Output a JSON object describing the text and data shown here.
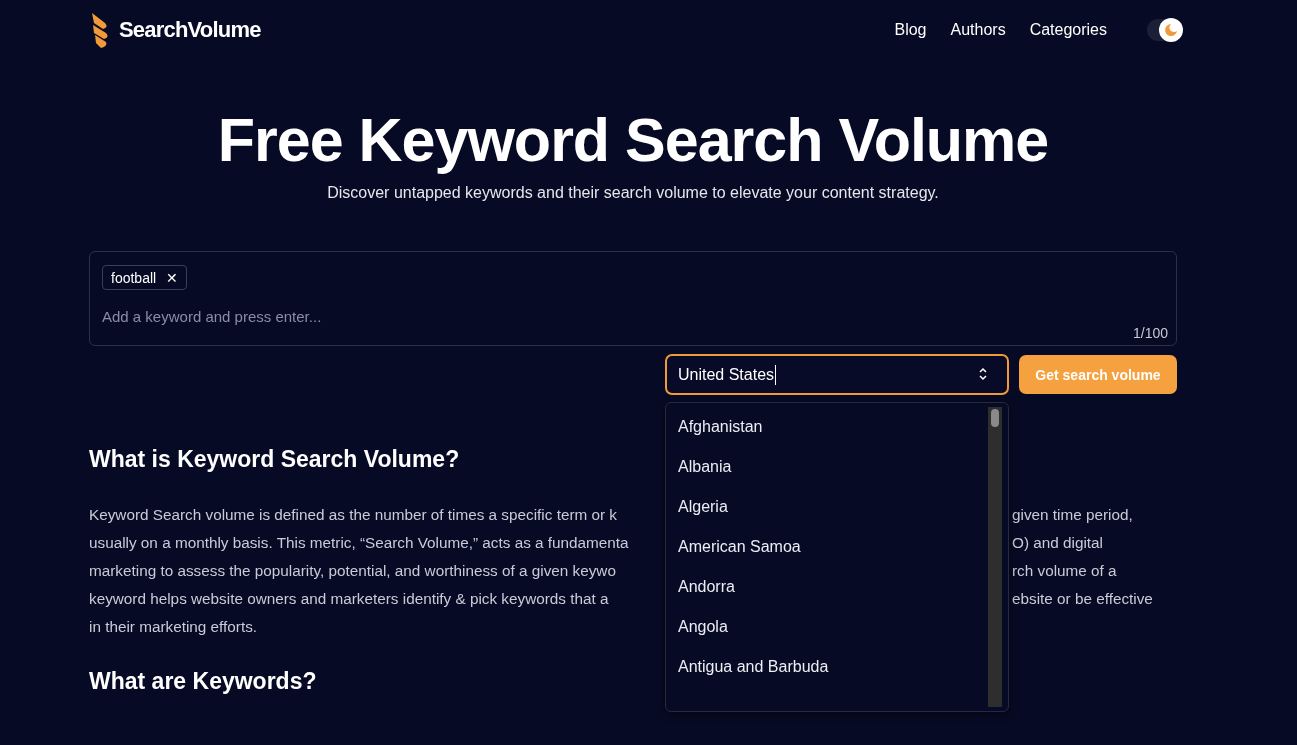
{
  "header": {
    "brand": "SearchVolume",
    "nav": [
      "Blog",
      "Authors",
      "Categories"
    ],
    "dark_mode": true
  },
  "hero": {
    "title": "Free Keyword Search Volume",
    "subtitle": "Discover untapped keywords and their search volume to elevate your content strategy."
  },
  "keyword_box": {
    "tags": [
      {
        "label": "football",
        "remove": "✕"
      }
    ],
    "placeholder": "Add a keyword and press enter...",
    "counter": "1/100"
  },
  "country_select": {
    "value": "United States",
    "expanded": true,
    "options": [
      {
        "label": "Afghanistan"
      },
      {
        "label": "Albania"
      },
      {
        "label": "Algeria"
      },
      {
        "label": "American Samoa"
      },
      {
        "label": "Andorra"
      },
      {
        "label": "Angola"
      },
      {
        "label": "Antigua and Barbuda"
      }
    ]
  },
  "submit_button": "Get search volume",
  "article": [
    {
      "kind": "heading",
      "text": "What is Keyword Search Volume?"
    },
    {
      "kind": "paragraph",
      "lines": [
        {
          "left": "Keyword Search volume is defined as the number of times a specific term or k",
          "right": "given time period,"
        },
        {
          "left": "usually on a monthly basis. This metric, “Search Volume,” acts as a fundamenta",
          "right": "O) and digital"
        },
        {
          "left": "marketing to assess the popularity, potential, and worthiness of a given keywo",
          "right": "rch volume of a"
        },
        {
          "left": "keyword helps website owners and marketers identify & pick keywords that a",
          "right": "ebsite or be effective"
        },
        {
          "left": "in their marketing efforts."
        }
      ]
    },
    {
      "kind": "heading",
      "text": "What are Keywords?"
    }
  ]
}
